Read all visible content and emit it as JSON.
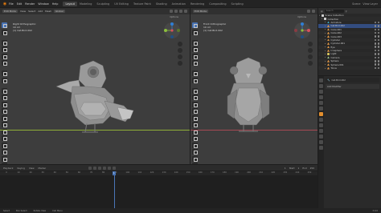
{
  "menubar": {
    "menus": [
      "File",
      "Edit",
      "Render",
      "Window",
      "Help"
    ],
    "workspaces": [
      "Layout",
      "Modeling",
      "Sculpting",
      "UV Editing",
      "Texture Paint",
      "Shading",
      "Animation",
      "Rendering",
      "Compositing",
      "Scripting"
    ],
    "active_workspace": "Layout",
    "scene_label": "Scene",
    "viewlayer_label": "View Layer"
  },
  "viewport_left": {
    "mode": "Edit Mode",
    "menus": [
      "View",
      "Select",
      "Add",
      "Mesh"
    ],
    "orientation": "Global",
    "view_name": "Right Orthographic",
    "scale": "10 cm",
    "subtitle": "(1) Cat.Bird.002",
    "options": "Options"
  },
  "viewport_right": {
    "mode": "Edit Mode",
    "view_name": "Front Orthographic",
    "scale": "10 cm",
    "subtitle": "(1) Cat.Bird.002",
    "options": "Options"
  },
  "outliner": {
    "search_placeholder": "Search",
    "items": [
      {
        "label": "Scene Collection",
        "type": "coll"
      },
      {
        "label": "Collection",
        "type": "coll"
      },
      {
        "label": "Armature",
        "type": "bone"
      },
      {
        "label": "Cat.Bird.002",
        "type": "mesh"
      },
      {
        "label": "Cube.001",
        "type": "mesh"
      },
      {
        "label": "Cube.002",
        "type": "mesh"
      },
      {
        "label": "Cube.003",
        "type": "mesh"
      },
      {
        "label": "Cylinder",
        "type": "mesh"
      },
      {
        "label": "Cylinder.001",
        "type": "mesh"
      },
      {
        "label": "Eye",
        "type": "mesh"
      },
      {
        "label": "Icosphere",
        "type": "mesh"
      },
      {
        "label": "Light",
        "type": "light"
      },
      {
        "label": "Camera",
        "type": "cam"
      },
      {
        "label": "Sphere",
        "type": "mesh"
      },
      {
        "label": "Sphere.001",
        "type": "mesh"
      },
      {
        "label": "Torus",
        "type": "mesh"
      }
    ]
  },
  "properties": {
    "rows": [
      "Cat.Bird.002",
      "Add Modifier"
    ]
  },
  "timeline": {
    "menus": [
      "Playback",
      "Keying",
      "View",
      "Marker"
    ],
    "current_frame": "1",
    "start_label": "Start",
    "start": "1",
    "end_label": "End",
    "end": "250",
    "ticks": [
      "0",
      "10",
      "20",
      "30",
      "40",
      "50",
      "60",
      "70",
      "80",
      "90",
      "100",
      "110",
      "120",
      "130",
      "140",
      "150",
      "160",
      "170",
      "180",
      "190",
      "200",
      "210",
      "220",
      "230",
      "240",
      "250"
    ]
  },
  "statusbar": {
    "left": "Select",
    "middle": "Box Select",
    "right_hint": "Rotate View",
    "context": "Call Menu",
    "version": "3.0.0"
  }
}
